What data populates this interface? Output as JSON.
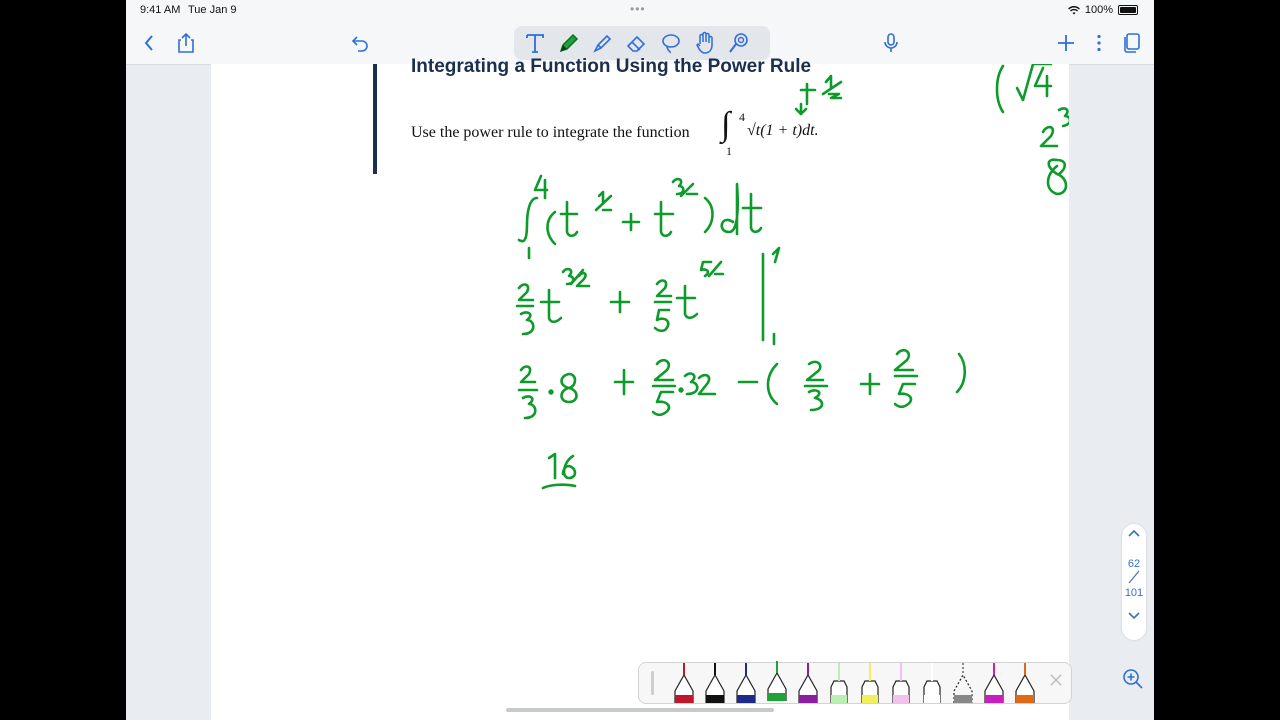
{
  "status": {
    "time": "9:41 AM",
    "date": "Tue Jan 9",
    "battery": "100%"
  },
  "toolbar": {
    "left_icons": [
      "chevron-left-icon",
      "share-icon",
      "undo-icon"
    ],
    "tools": [
      "text-tool-icon",
      "pen-tool-icon",
      "highlighter-tool-icon",
      "eraser-tool-icon",
      "lasso-tool-icon",
      "hand-tool-icon",
      "laser-tool-icon"
    ],
    "selected_tool": "pen-tool-icon",
    "right_icons": [
      "microphone-icon",
      "plus-icon",
      "more-icon",
      "pages-icon"
    ],
    "accent": "#2f6fd8"
  },
  "document": {
    "title": "Integrating a Function Using the Power Rule",
    "prompt": "Use the power rule to integrate the function",
    "integral": {
      "lower": "1",
      "upper": "4",
      "integrand": "√t(1 + t)dt."
    },
    "ink_color": "#0f9a2c",
    "title_color": "#1b2f4f"
  },
  "page_indicator": {
    "current": "62",
    "total": "101"
  },
  "pens": [
    {
      "name": "red-pen",
      "color": "#c0172c"
    },
    {
      "name": "black-pen",
      "color": "#111111"
    },
    {
      "name": "navy-pen",
      "color": "#1d2a8a"
    },
    {
      "name": "green-pen",
      "color": "#1fa336",
      "selected": true
    },
    {
      "name": "purple-pen",
      "color": "#8b1ea3"
    },
    {
      "name": "light-green-highlighter",
      "color": "#b7f0b0"
    },
    {
      "name": "yellow-highlighter",
      "color": "#f2f05a"
    },
    {
      "name": "pink-highlighter",
      "color": "#f2c2ef"
    },
    {
      "name": "white-highlighter",
      "color": "#ffffff"
    },
    {
      "name": "dashed-lasso",
      "color": "#888888"
    },
    {
      "name": "magenta-pen",
      "color": "#c81fc0"
    },
    {
      "name": "orange-pen",
      "color": "#e06a14"
    }
  ]
}
